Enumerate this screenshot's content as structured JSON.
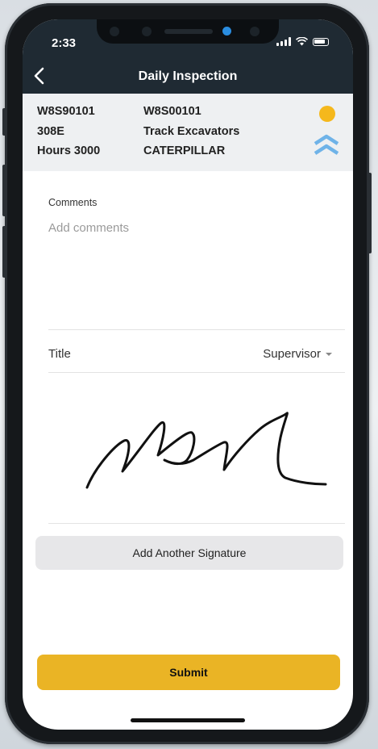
{
  "status_bar": {
    "time": "2:33"
  },
  "header": {
    "title": "Daily Inspection"
  },
  "equipment": {
    "serial": "W8S90101",
    "model": "308E",
    "hours": "Hours 3000",
    "asset_id": "W8S00101",
    "type": "Track Excavators",
    "make": "CATERPILLAR",
    "status_color": "#f5b81c",
    "priority_color": "#6fb3e8"
  },
  "form": {
    "comments_label": "Comments",
    "comments_placeholder": "Add comments",
    "comments_value": "",
    "title_label": "Title",
    "title_value": "Supervisor"
  },
  "buttons": {
    "add_signature": "Add Another Signature",
    "submit": "Submit"
  },
  "colors": {
    "header_bg": "#1f2a33",
    "submit_bg": "#eab425"
  }
}
